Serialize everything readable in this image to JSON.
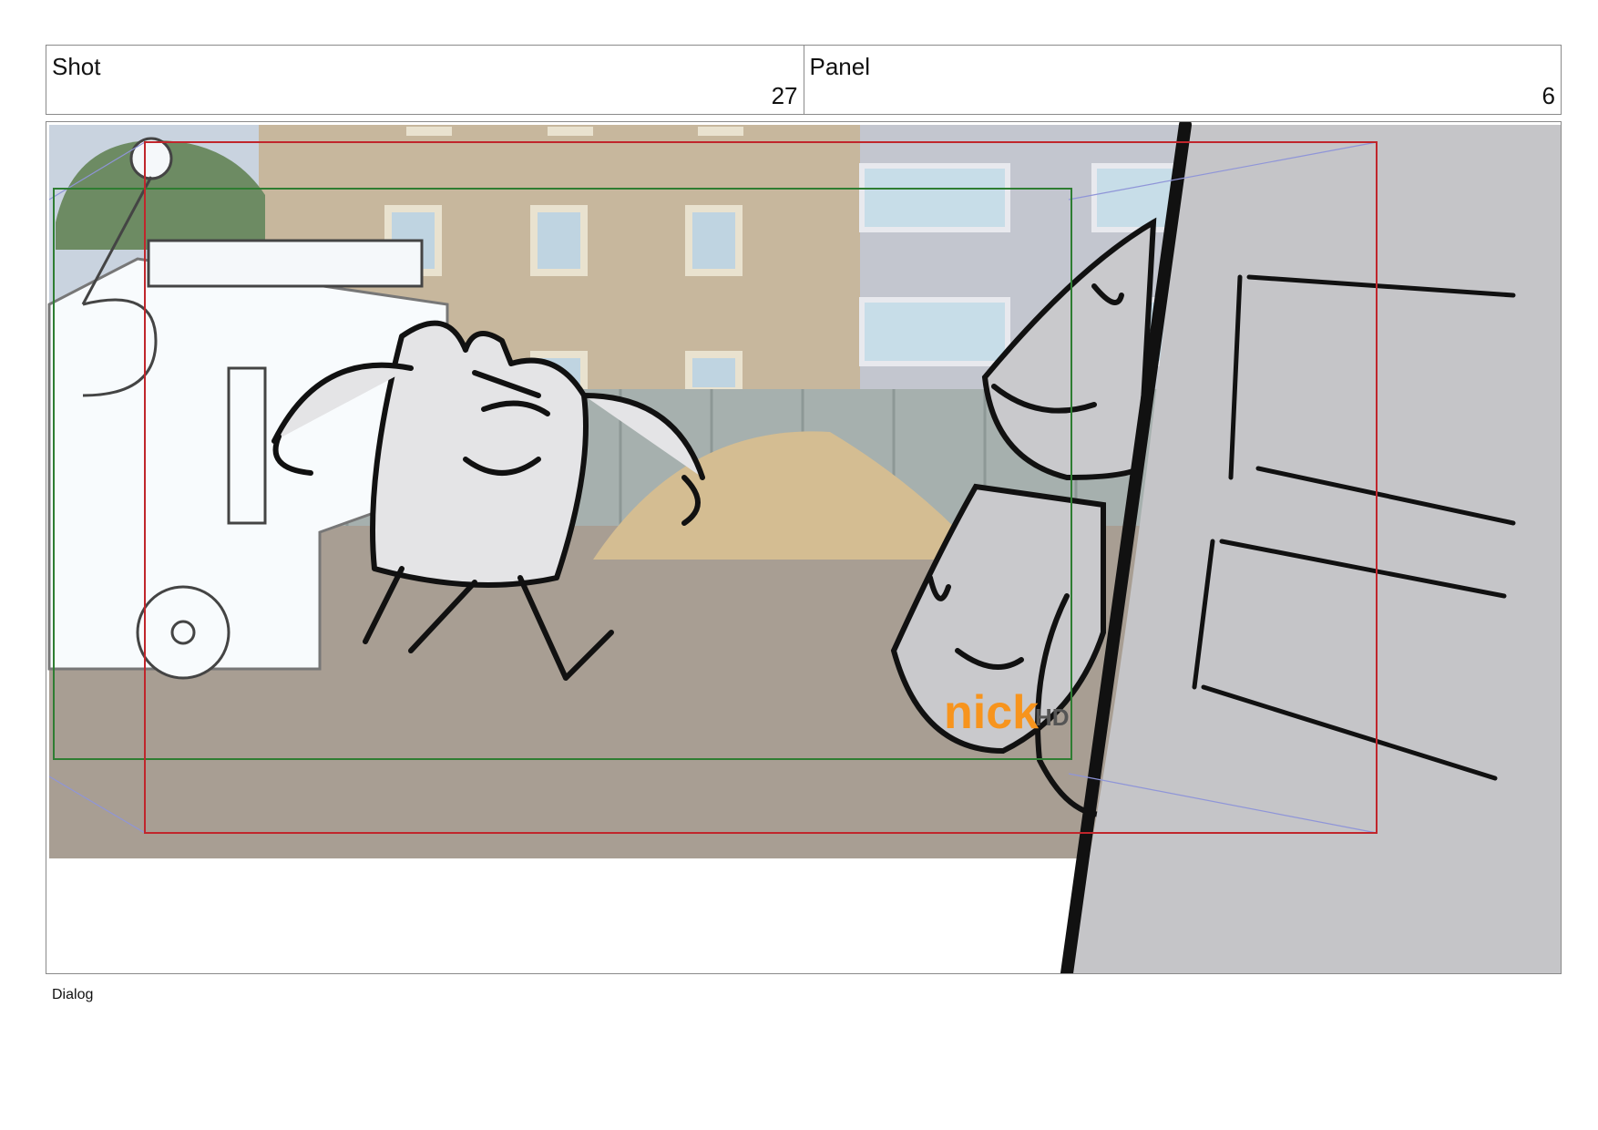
{
  "header": {
    "shot_label": "Shot",
    "shot_number": "27",
    "panel_label": "Panel",
    "panel_number": "6"
  },
  "frame": {
    "watermark_logo": "nick",
    "watermark_badge": "HD",
    "colors": {
      "action_safe": "#c0262c",
      "title_safe": "#2e7d32",
      "watermark": "#f7941d"
    }
  },
  "footer": {
    "dialog_label": "Dialog"
  }
}
